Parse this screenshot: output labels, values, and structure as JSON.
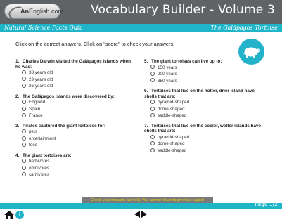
{
  "header": {
    "logo_prefix": "An",
    "logo_suffix": "English.com",
    "app_title": "Vocabulary Builder - Volume 3"
  },
  "subheader": {
    "left": "Natural Science Facts Quiz",
    "right": "The Galápagos Tortoise"
  },
  "instructions": "Click on the correct answers.  Click on \"score\" to check your answers.",
  "questions_left": [
    {
      "num": "1.",
      "text": "Charles Darwin visited the Galápagos Islands when he was:",
      "options": [
        "33 years old",
        "29 years old",
        "26 years old"
      ]
    },
    {
      "num": "2.",
      "text": "The Galápagos Islands were discovered by:",
      "options": [
        "England",
        "Spain",
        "France"
      ]
    },
    {
      "num": "3.",
      "text": "Pirates captured the giant tortoises for:",
      "options": [
        "pets",
        "entertainment",
        "food"
      ]
    },
    {
      "num": "4.",
      "text": "The giant tortoises are:",
      "options": [
        "herbivores",
        "omnivores",
        "carnivores"
      ]
    }
  ],
  "questions_right": [
    {
      "num": "5.",
      "text": "The giant tortoises can live up to:",
      "options": [
        "150 years",
        "200 years",
        "350 years"
      ]
    },
    {
      "num": "6.",
      "text": "Tortoises that live on the hotter, drier island have shells that are:",
      "options": [
        "pyramid-shaped",
        "dome-shaped",
        "saddle-shaped"
      ]
    },
    {
      "num": "7.",
      "text": "Tortoises that live on the cooler, wetter islands have shells that are:",
      "options": [
        "pyramid-shaped",
        "dome-shaped",
        "saddle-shaped"
      ]
    }
  ],
  "warning": "Check your answers carefully. You cannot return to previous pages!",
  "page_label": "Page 1/2",
  "footer": {
    "info_glyph": "i"
  },
  "icons": {
    "badge": "tortoise-icon",
    "home": "home-icon",
    "info": "info-icon",
    "prev": "triangle-left-icon",
    "next": "triangle-right-icon"
  },
  "colors": {
    "header_bg": "#5f6366",
    "accent": "#1fb5c9",
    "warning_text": "#f2d400"
  }
}
